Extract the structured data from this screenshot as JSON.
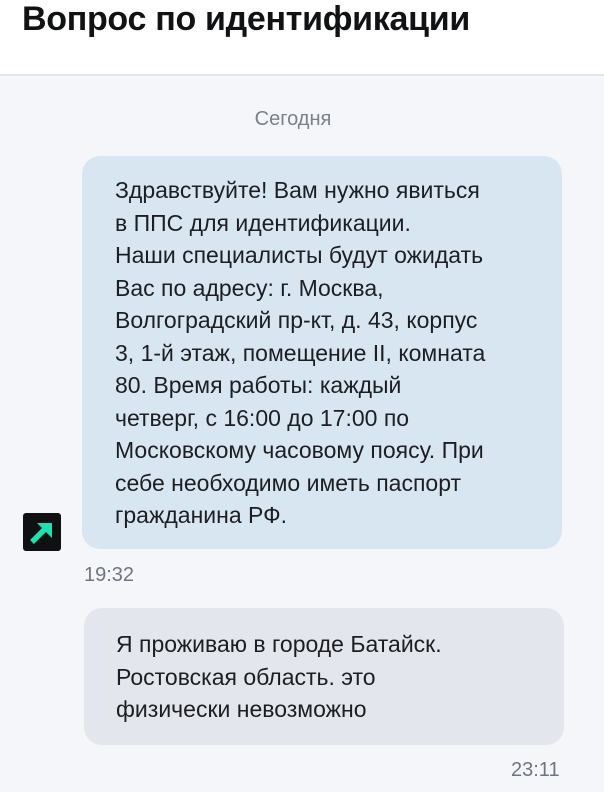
{
  "header": {
    "title": "Вопрос по идентификации"
  },
  "chat": {
    "date_separator": "Сегодня",
    "incoming": {
      "lines": [
        "Здравствуйте! Вам нужно явиться",
        "в ППС для идентификации.",
        "Наши специалисты будут ожидать",
        "Вас по адресу: г. Москва,",
        "Волгоградский пр-кт, д. 43, корпус",
        "3, 1-й этаж, помещение II, комната",
        "80. Время работы: каждый",
        "четверг, с 16:00 до 17:00 по",
        "Московскому часовому поясу. При",
        "себе необходимо иметь паспорт",
        "гражданина РФ."
      ],
      "time": "19:32",
      "avatar_icon": "arrow-up-right-icon",
      "avatar_colors": {
        "background": "#0f1012",
        "arrow": "#1fe0b0"
      }
    },
    "outgoing": {
      "lines": [
        "Я проживаю в городе Батайск.",
        "Ростовская область. это",
        "физически невозможно"
      ],
      "time": "23:11"
    }
  },
  "colors": {
    "incoming_bubble": "#d8e6f2",
    "outgoing_bubble": "#e3e6ec",
    "background": "#f4f6fa"
  }
}
